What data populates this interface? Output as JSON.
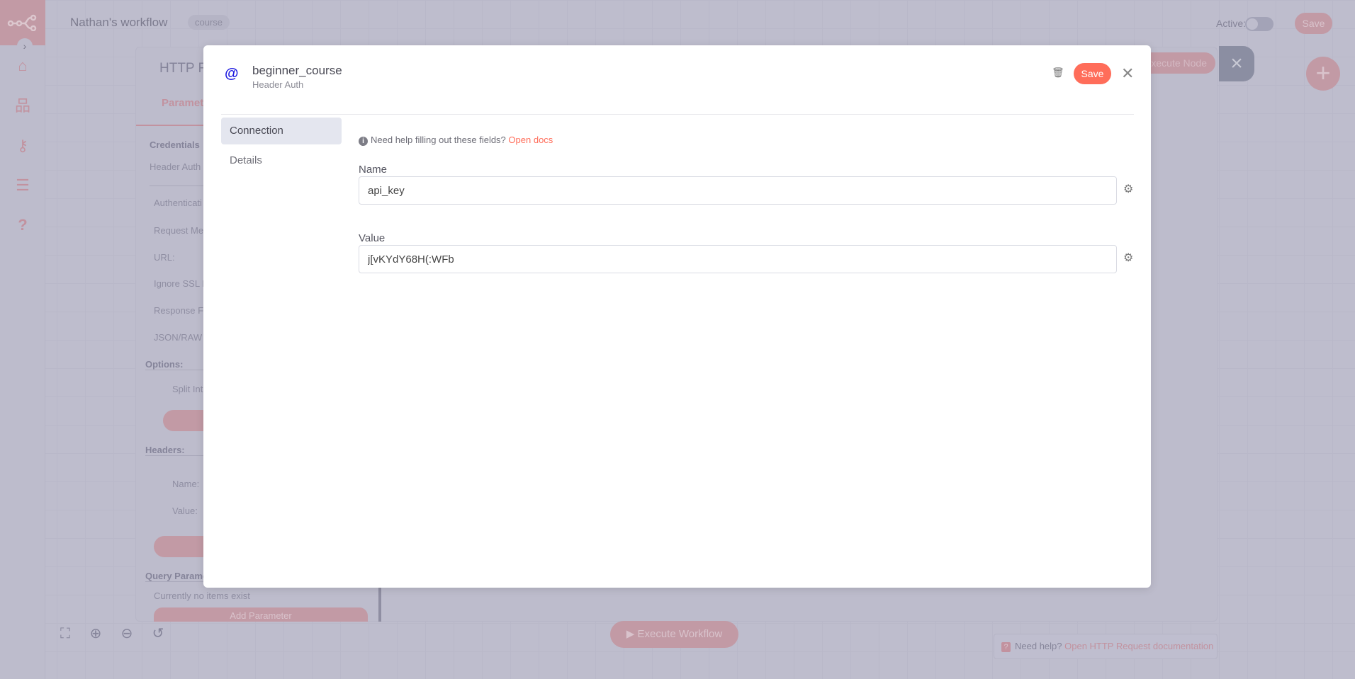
{
  "topbar": {
    "workflow_name": "Nathan's workflow",
    "tag": "course",
    "active_label": "Active:",
    "active": false,
    "save_label": "Save"
  },
  "sidebar": {
    "items": [
      {
        "icon": "home-icon"
      },
      {
        "icon": "network-icon"
      },
      {
        "icon": "key-icon"
      },
      {
        "icon": "list-icon"
      },
      {
        "icon": "help-icon"
      }
    ]
  },
  "node_panel": {
    "title": "HTTP R",
    "tab": "Paramet",
    "credentials_label": "Credentials",
    "header_auth": "Header Auth",
    "fields": [
      "Authenticati",
      "Request Me",
      "URL:",
      "Ignore SSL I",
      "Response Fo",
      "JSON/RAW F"
    ],
    "options_label": "Options:",
    "split_into": "Split Int",
    "headers_label": "Headers:",
    "header_name": "Name:",
    "header_value": "Value:",
    "query_label": "Query Parame",
    "no_items": "Currently no items exist",
    "add_parameter": "Add Parameter",
    "execute_node": "xecute Node"
  },
  "canvas": {
    "execute_workflow": "Execute Workflow",
    "help_text": "Need help?",
    "help_link": "Open HTTP Request documentation"
  },
  "modal": {
    "title": "beginner_course",
    "subtitle": "Header Auth",
    "save_label": "Save",
    "nav": [
      {
        "label": "Connection",
        "active": true
      },
      {
        "label": "Details",
        "active": false
      }
    ],
    "help_text": "Need help filling out these fields?",
    "help_link": "Open docs",
    "fields": [
      {
        "label": "Name",
        "value": "api_key"
      },
      {
        "label": "Value",
        "value": "j[vKYdY68H(:WFb"
      }
    ]
  },
  "colors": {
    "accent": "#ff6d5a",
    "icon_blue": "#1d1ae0"
  }
}
